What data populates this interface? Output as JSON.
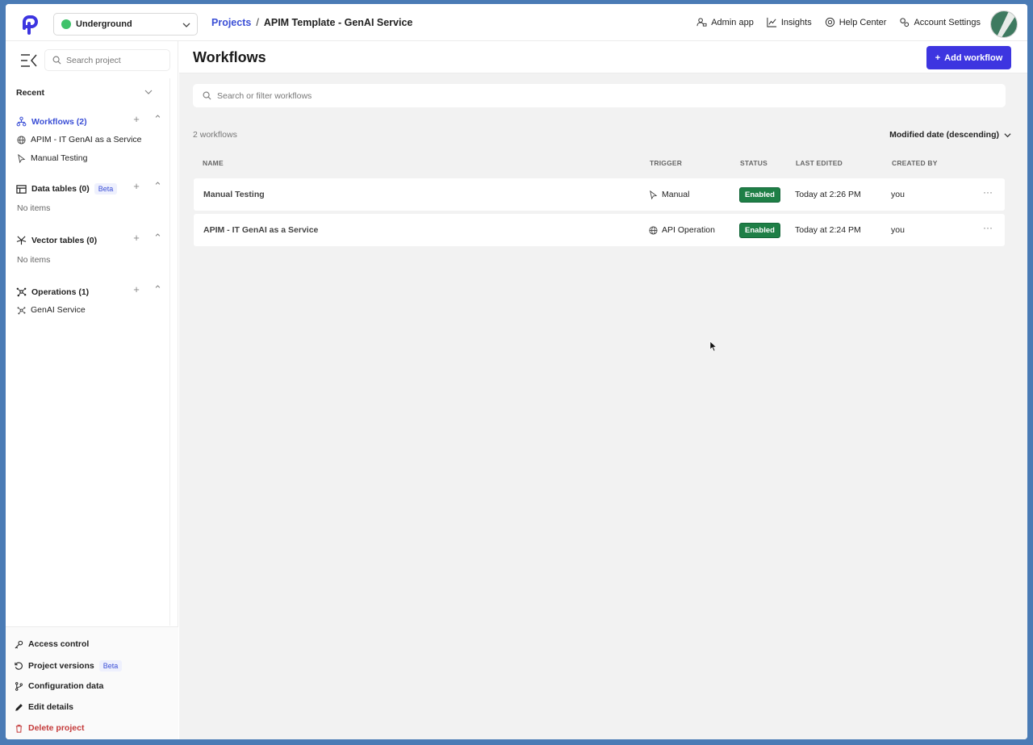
{
  "topbar": {
    "workspace": "Underground",
    "breadcrumb": {
      "root": "Projects",
      "separator": "/",
      "current": "APIM Template - GenAI Service"
    },
    "nav": [
      {
        "label": "Admin app",
        "icon": "admin-icon"
      },
      {
        "label": "Insights",
        "icon": "chart-icon"
      },
      {
        "label": "Help Center",
        "icon": "help-icon"
      },
      {
        "label": "Account Settings",
        "icon": "settings-icon"
      }
    ]
  },
  "sidebar": {
    "search_placeholder": "Search project",
    "recent_label": "Recent",
    "workflows_label": "Workflows (2)",
    "workflow_items": [
      {
        "label": "APIM - IT GenAI as a Service",
        "icon": "globe-icon"
      },
      {
        "label": "Manual Testing",
        "icon": "cursor-icon"
      }
    ],
    "data_tables_label": "Data tables (0)",
    "beta_label": "Beta",
    "data_tables_empty": "No items",
    "vector_tables_label": "Vector tables (0)",
    "vector_tables_empty": "No items",
    "operations_label": "Operations (1)",
    "operation_items": [
      {
        "label": "GenAI Service",
        "icon": "operation-icon"
      }
    ],
    "bottom": {
      "access_control": "Access control",
      "project_versions": "Project versions",
      "project_versions_badge": "Beta",
      "configuration_data": "Configuration data",
      "edit_details": "Edit details",
      "delete_project": "Delete project"
    }
  },
  "main": {
    "title": "Workflows",
    "add_button": "Add workflow",
    "add_button_prefix": "+",
    "search_placeholder": "Search or filter workflows",
    "count": "2 workflows",
    "sort": "Modified date (descending)",
    "columns": {
      "name": "NAME",
      "trigger": "TRIGGER",
      "status": "STATUS",
      "last_edited": "LAST EDITED",
      "created_by": "CREATED BY"
    },
    "rows": [
      {
        "name": "Manual Testing",
        "trigger": "Manual",
        "trigger_icon": "cursor-icon",
        "status": "Enabled",
        "last_edited": "Today at 2:26 PM",
        "created_by": "you",
        "more": "···"
      },
      {
        "name": "APIM - IT GenAI as a Service",
        "trigger": "API Operation",
        "trigger_icon": "globe-icon",
        "status": "Enabled",
        "last_edited": "Today at 2:24 PM",
        "created_by": "you",
        "more": "···"
      }
    ]
  },
  "colors": {
    "accent": "#3d35e0",
    "link": "#3b4fd6",
    "status_enabled": "#1e7f46",
    "workspace_dot": "#3fc26a",
    "danger": "#c43a3a"
  }
}
